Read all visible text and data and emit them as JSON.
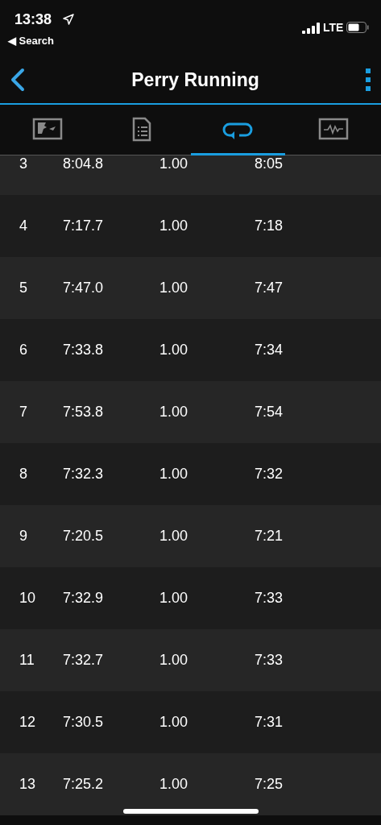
{
  "status_bar": {
    "time": "13:38",
    "back_label": "◀ Search",
    "network": "LTE"
  },
  "nav": {
    "title": "Perry Running"
  },
  "tabs": [
    {
      "kind": "map",
      "selected": false
    },
    {
      "kind": "details",
      "selected": false
    },
    {
      "kind": "laps",
      "selected": true
    },
    {
      "kind": "chart",
      "selected": false
    }
  ],
  "laps": [
    {
      "lap": "3",
      "time": "8:04.8",
      "distance": "1.00",
      "pace": "8:05"
    },
    {
      "lap": "4",
      "time": "7:17.7",
      "distance": "1.00",
      "pace": "7:18"
    },
    {
      "lap": "5",
      "time": "7:47.0",
      "distance": "1.00",
      "pace": "7:47"
    },
    {
      "lap": "6",
      "time": "7:33.8",
      "distance": "1.00",
      "pace": "7:34"
    },
    {
      "lap": "7",
      "time": "7:53.8",
      "distance": "1.00",
      "pace": "7:54"
    },
    {
      "lap": "8",
      "time": "7:32.3",
      "distance": "1.00",
      "pace": "7:32"
    },
    {
      "lap": "9",
      "time": "7:20.5",
      "distance": "1.00",
      "pace": "7:21"
    },
    {
      "lap": "10",
      "time": "7:32.9",
      "distance": "1.00",
      "pace": "7:33"
    },
    {
      "lap": "11",
      "time": "7:32.7",
      "distance": "1.00",
      "pace": "7:33"
    },
    {
      "lap": "12",
      "time": "7:30.5",
      "distance": "1.00",
      "pace": "7:31"
    },
    {
      "lap": "13",
      "time": "7:25.2",
      "distance": "1.00",
      "pace": "7:25"
    }
  ]
}
